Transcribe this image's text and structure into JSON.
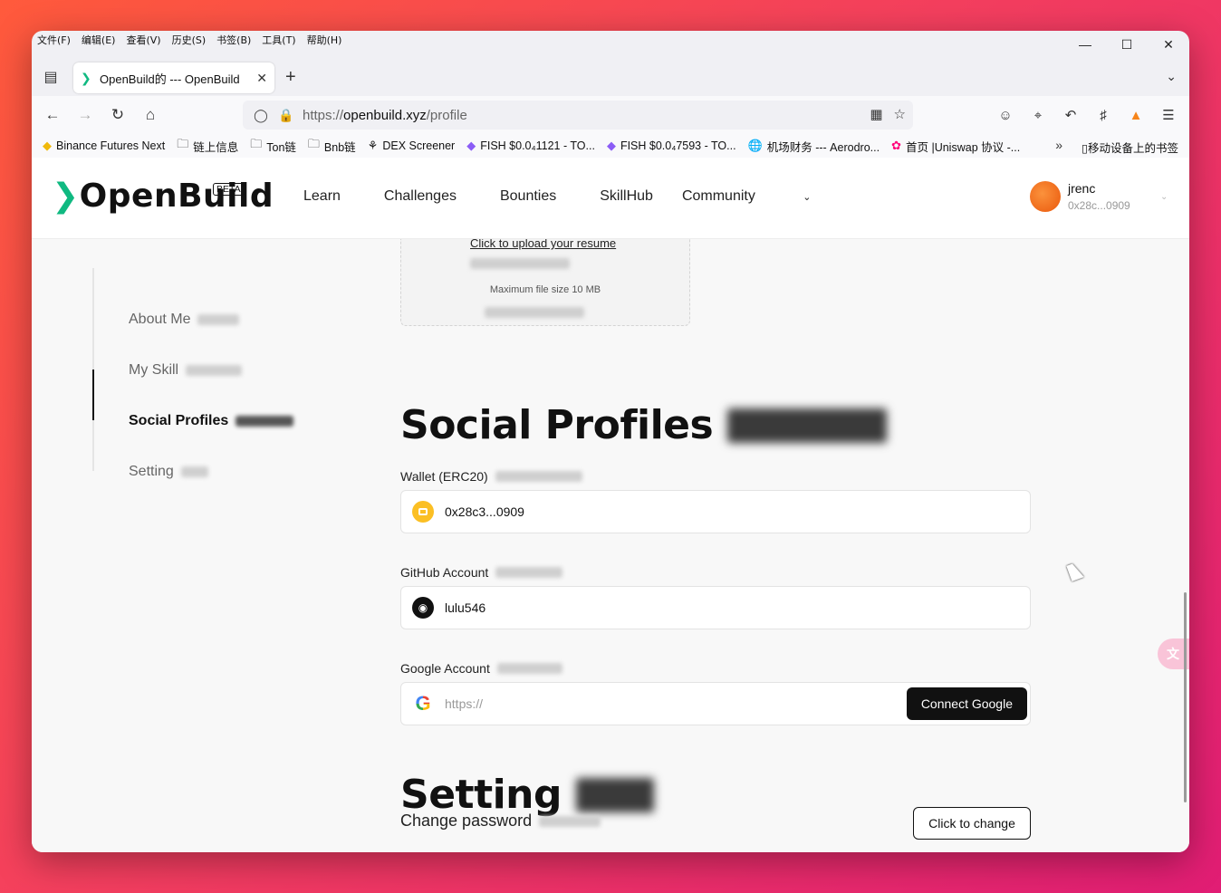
{
  "menubar": [
    "文件(F)",
    "编辑(E)",
    "查看(V)",
    "历史(S)",
    "书签(B)",
    "工具(T)",
    "帮助(H)"
  ],
  "tab": {
    "title": "OpenBuild的 --- OpenBuild"
  },
  "url": {
    "scheme": "https://",
    "host": "openbuild.xyz",
    "path": "/profile"
  },
  "bookmarks": [
    {
      "icon": "binance-icon",
      "label": "Binance Futures Next"
    },
    {
      "icon": "folder-icon",
      "label": "链上信息"
    },
    {
      "icon": "folder-icon",
      "label": "Ton链"
    },
    {
      "icon": "folder-icon",
      "label": "Bnb链"
    },
    {
      "icon": "dex-icon",
      "label": "DEX Screener"
    },
    {
      "icon": "fish-icon",
      "label": "FISH $0.0₄1121 - TO..."
    },
    {
      "icon": "fish-icon",
      "label": "FISH $0.0₄7593 - TO..."
    },
    {
      "icon": "globe-icon",
      "label": "机场财务 --- Aerodro..."
    },
    {
      "icon": "uniswap-icon",
      "label": "首页 |Uniswap 协议 -..."
    }
  ],
  "bookmarks_mobile": "移动设备上的书签",
  "site": {
    "logo": "OpenBuild",
    "beta": "BETA",
    "nav": [
      "Learn",
      "Challenges",
      "Bounties",
      "SkillHub",
      "Community"
    ],
    "user": {
      "name": "jrenc",
      "address": "0x28c...0909"
    }
  },
  "sidebar": [
    {
      "label": "About Me",
      "active": false
    },
    {
      "label": "My Skill",
      "active": false
    },
    {
      "label": "Social Profiles",
      "active": true
    },
    {
      "label": "Setting",
      "active": false
    }
  ],
  "upload": {
    "link": "Click to upload your resume",
    "max_size": "Maximum file size 10 MB"
  },
  "social": {
    "heading": "Social Profiles",
    "wallet_label": "Wallet (ERC20)",
    "wallet_value": "0x28c3...0909",
    "github_label": "GitHub Account",
    "github_value": "lulu546",
    "google_label": "Google Account",
    "google_placeholder": "https://",
    "connect_google": "Connect Google"
  },
  "setting": {
    "heading": "Setting",
    "change_password_label": "Change password",
    "change_button": "Click to change"
  },
  "colors": {
    "brand": "#10b981",
    "accent": "#111111",
    "wallet": "#fbbf24"
  }
}
